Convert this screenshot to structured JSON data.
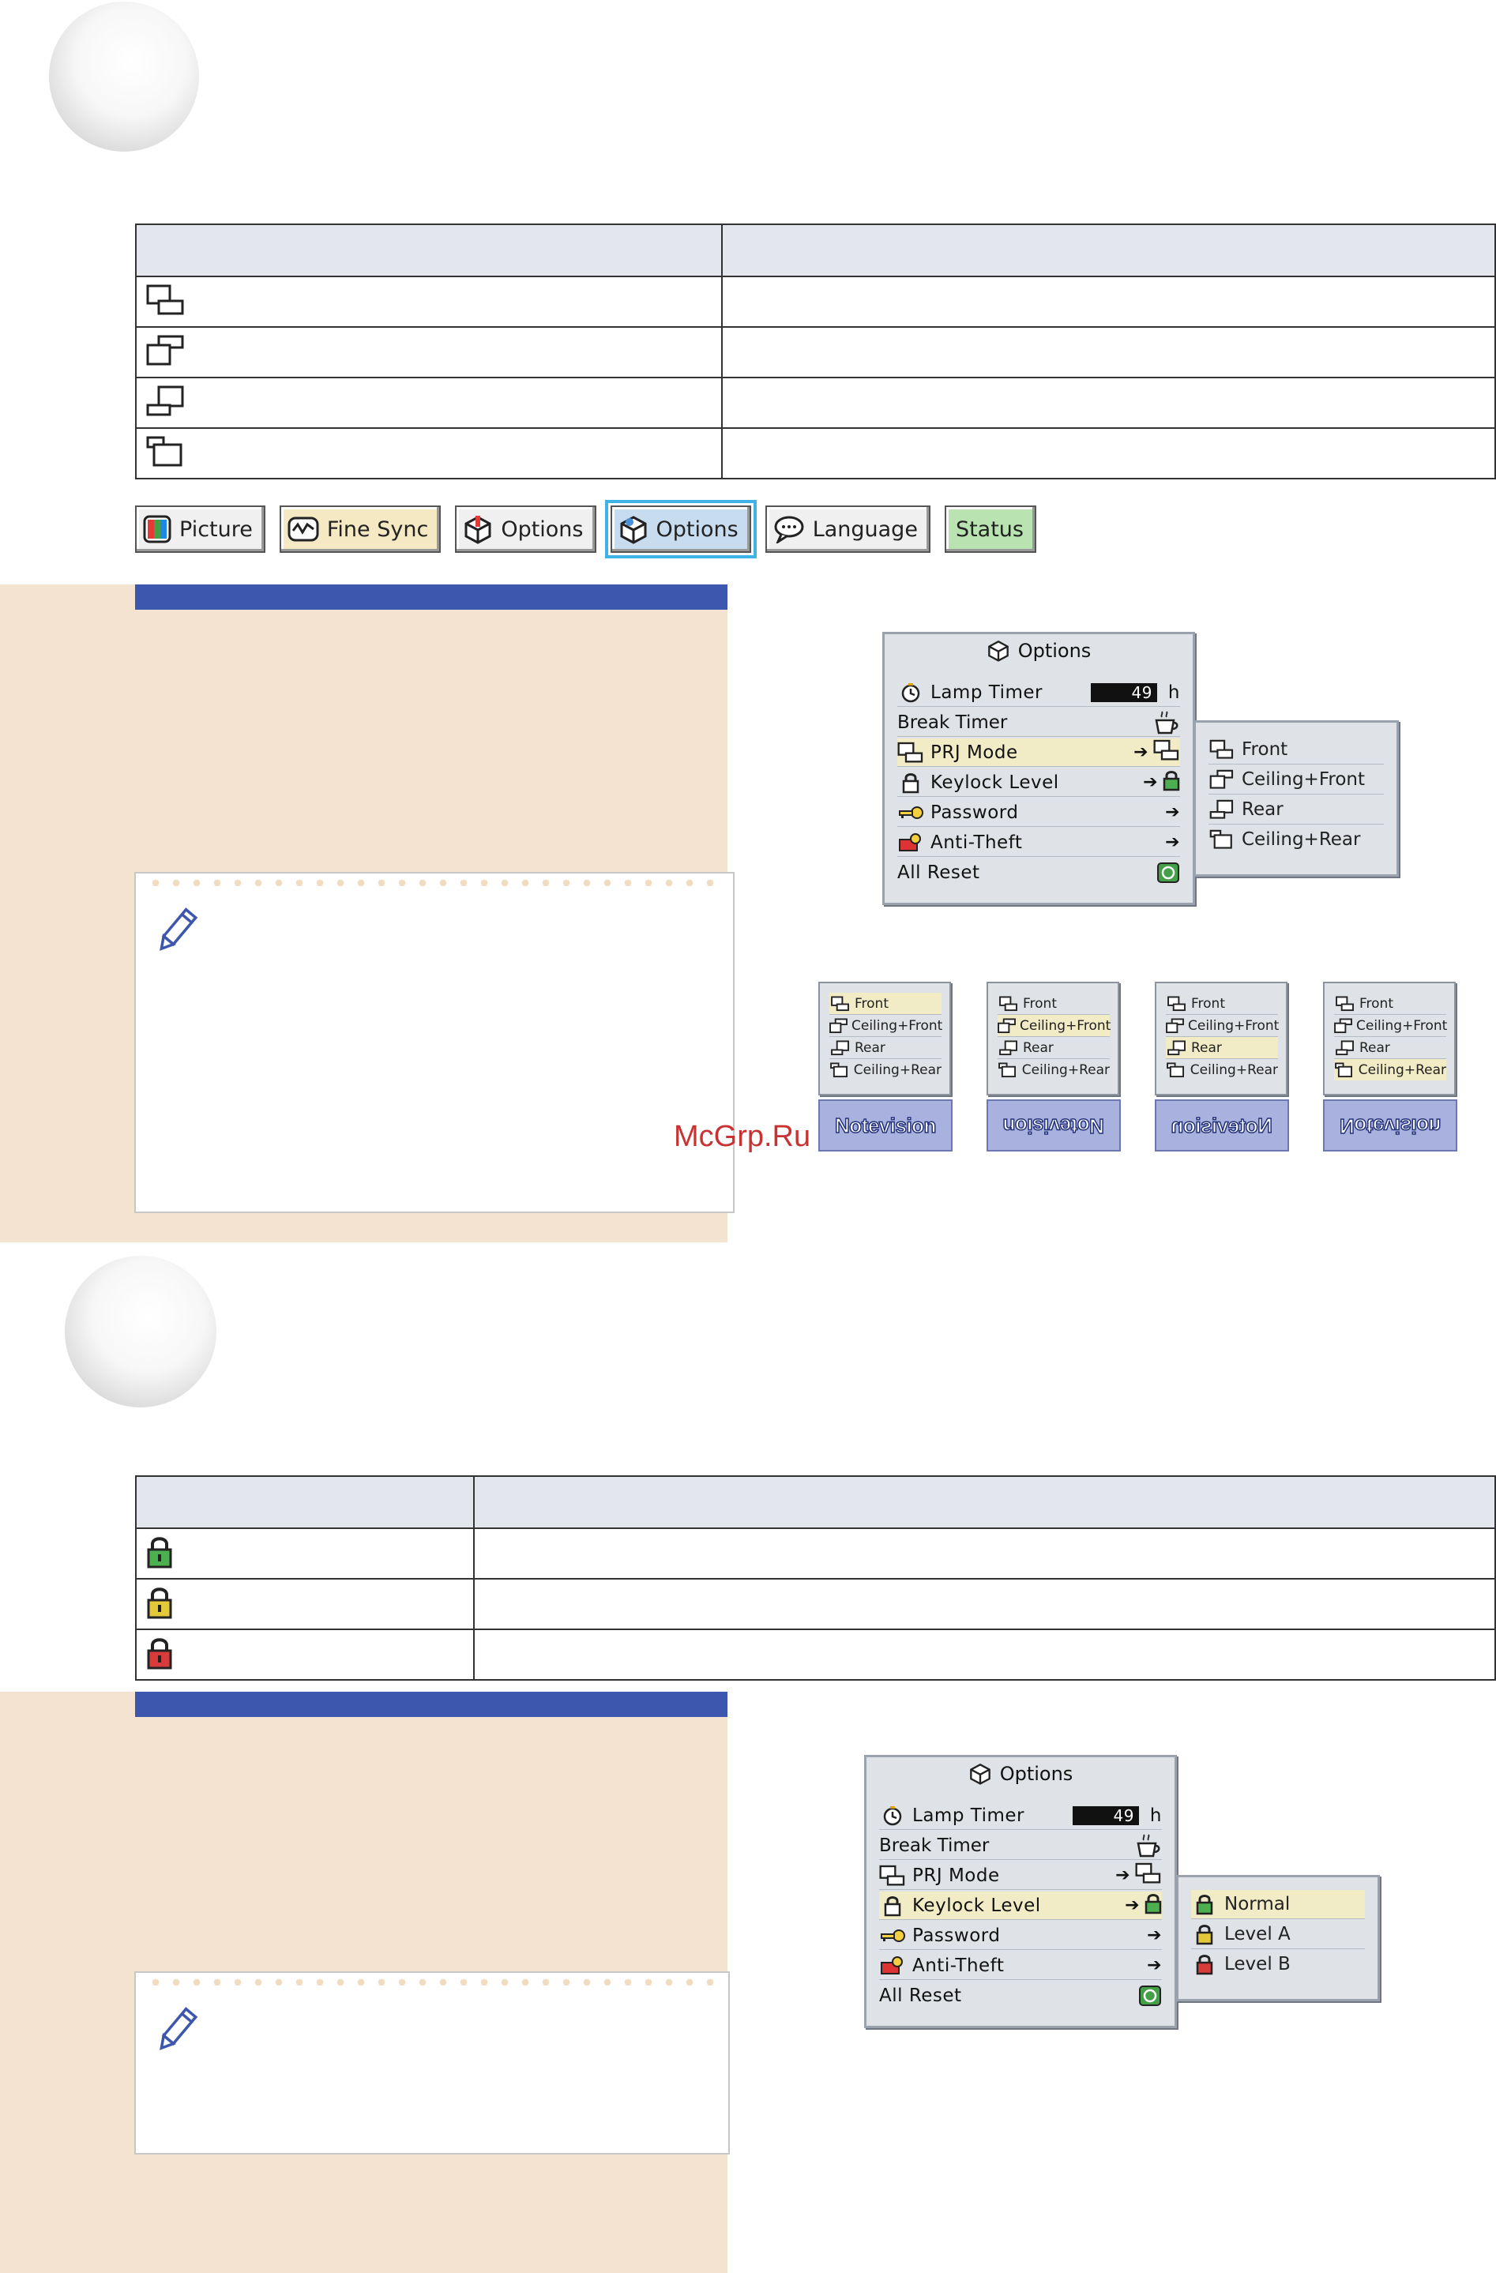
{
  "prj_table": {
    "headers": [
      "",
      ""
    ],
    "rows": [
      {
        "icon": "prj-front-icon",
        "label": "",
        "desc": ""
      },
      {
        "icon": "prj-ceiling-front-icon",
        "label": "",
        "desc": ""
      },
      {
        "icon": "prj-rear-icon",
        "label": "",
        "desc": ""
      },
      {
        "icon": "prj-ceiling-rear-icon",
        "label": "",
        "desc": ""
      }
    ]
  },
  "menu_tabs": [
    {
      "label": "Picture",
      "icon": "picture-icon",
      "bg": "#f0f0f0"
    },
    {
      "label": "Fine Sync",
      "icon": "fine-sync-icon",
      "bg": "#f5e9c4"
    },
    {
      "label": "Options",
      "icon": "options1-icon",
      "bg": "#f0f0f0"
    },
    {
      "label": "Options",
      "icon": "options2-icon",
      "bg": "#c7dcee",
      "active": true
    },
    {
      "label": "Language",
      "icon": "language-icon",
      "bg": "#f0f0f0"
    },
    {
      "label": "Status",
      "icon": "",
      "bg": "#b9e3b0"
    }
  ],
  "osd": {
    "title": "Options",
    "lamp_timer": "Lamp Timer",
    "lamp_value": "49",
    "lamp_unit": "h",
    "break_timer": "Break Timer",
    "prj_mode": "PRJ Mode",
    "keylock_level": "Keylock Level",
    "password": "Password",
    "anti_theft": "Anti-Theft",
    "all_reset": "All Reset"
  },
  "prj_submenu": [
    "Front",
    "Ceiling+Front",
    "Rear",
    "Ceiling+Rear"
  ],
  "mini_menus": [
    {
      "items": [
        "Front",
        "Ceiling+Front",
        "Rear",
        "Ceiling+Rear"
      ],
      "selected": 0,
      "logo": "Notevision"
    },
    {
      "items": [
        "Front",
        "Ceiling+Front",
        "Rear",
        "Ceiling+Rear"
      ],
      "selected": 1,
      "logo": "Notevision"
    },
    {
      "items": [
        "Front",
        "Ceiling+Front",
        "Rear",
        "Ceiling+Rear"
      ],
      "selected": 2,
      "logo": "Notevision"
    },
    {
      "items": [
        "Front",
        "Ceiling+Front",
        "Rear",
        "Ceiling+Rear"
      ],
      "selected": 3,
      "logo": "Notevision"
    }
  ],
  "watermark": "McGrp.Ru",
  "keylock_table": {
    "headers": [
      "",
      ""
    ],
    "rows": [
      {
        "icon": "lock-green-icon",
        "label": "",
        "desc": ""
      },
      {
        "icon": "lock-yellow-icon",
        "label": "",
        "desc": ""
      },
      {
        "icon": "lock-red-icon",
        "label": "",
        "desc": ""
      }
    ]
  },
  "keylock_submenu": [
    "Normal",
    "Level A",
    "Level B"
  ],
  "colors": {
    "panel": "#f4e3d1",
    "bar": "#3c57ad",
    "lock_green": "#4caf50",
    "lock_yellow": "#e3c93a",
    "lock_red": "#d93b3b"
  }
}
